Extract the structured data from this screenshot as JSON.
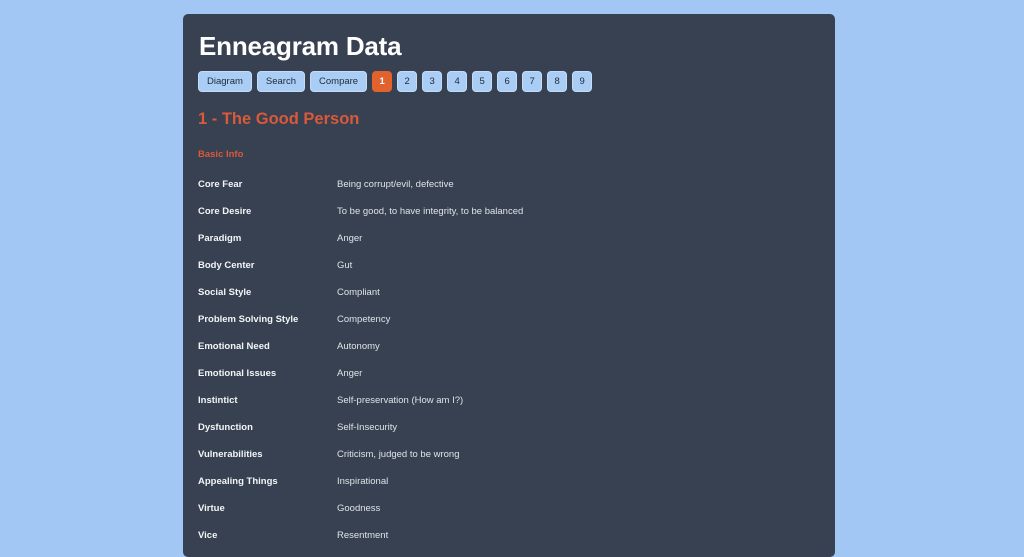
{
  "app": {
    "title": "Enneagram Data",
    "background_color": "#a3c7f5",
    "card_color": "#374151",
    "accent_color": "#d9593a",
    "nav_button_color": "#a9cdf4",
    "active_button_color": "#e2622e"
  },
  "nav": {
    "buttons": [
      {
        "label": "Diagram",
        "active": false,
        "kind": "text"
      },
      {
        "label": "Search",
        "active": false,
        "kind": "text"
      },
      {
        "label": "Compare",
        "active": false,
        "kind": "text"
      },
      {
        "label": "1",
        "active": true,
        "kind": "num"
      },
      {
        "label": "2",
        "active": false,
        "kind": "num"
      },
      {
        "label": "3",
        "active": false,
        "kind": "num"
      },
      {
        "label": "4",
        "active": false,
        "kind": "num"
      },
      {
        "label": "5",
        "active": false,
        "kind": "num"
      },
      {
        "label": "6",
        "active": false,
        "kind": "num"
      },
      {
        "label": "7",
        "active": false,
        "kind": "num"
      },
      {
        "label": "8",
        "active": false,
        "kind": "num"
      },
      {
        "label": "9",
        "active": false,
        "kind": "num"
      }
    ]
  },
  "main": {
    "type_heading": "1 - The Good Person",
    "section_heading": "Basic Info",
    "rows": [
      {
        "label": "Core Fear",
        "value": "Being corrupt/evil, defective"
      },
      {
        "label": "Core Desire",
        "value": "To be good, to have integrity, to be balanced"
      },
      {
        "label": "Paradigm",
        "value": "Anger"
      },
      {
        "label": "Body Center",
        "value": "Gut"
      },
      {
        "label": "Social Style",
        "value": "Compliant"
      },
      {
        "label": "Problem Solving Style",
        "value": "Competency"
      },
      {
        "label": "Emotional Need",
        "value": "Autonomy"
      },
      {
        "label": "Emotional Issues",
        "value": "Anger"
      },
      {
        "label": "Instintict",
        "value": "Self-preservation (How am I?)"
      },
      {
        "label": "Dysfunction",
        "value": "Self-Insecurity"
      },
      {
        "label": "Vulnerabilities",
        "value": "Criticism, judged to be wrong"
      },
      {
        "label": "Appealing Things",
        "value": "Inspirational"
      },
      {
        "label": "Virtue",
        "value": "Goodness"
      },
      {
        "label": "Vice",
        "value": "Resentment"
      }
    ]
  }
}
